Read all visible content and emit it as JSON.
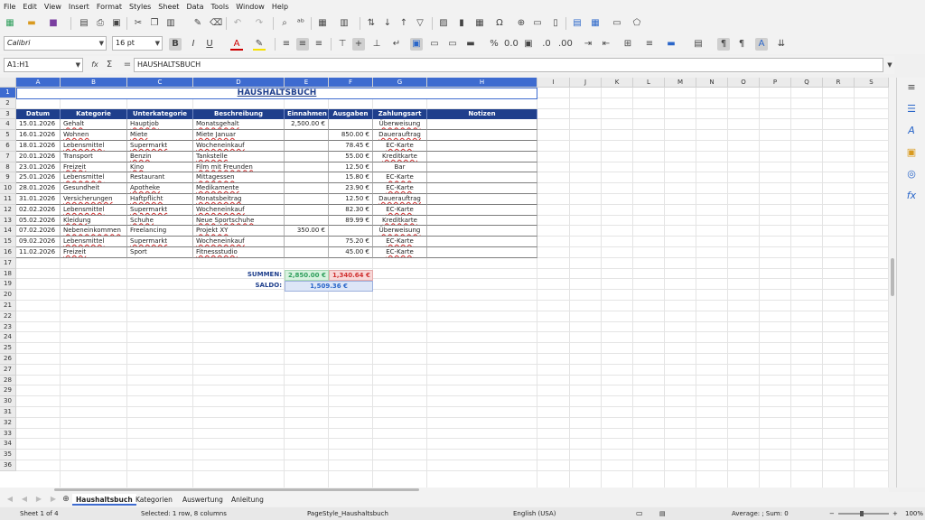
{
  "menu": [
    "File",
    "Edit",
    "View",
    "Insert",
    "Format",
    "Styles",
    "Sheet",
    "Data",
    "Tools",
    "Window",
    "Help"
  ],
  "toolbar": {
    "font_name": "Calibri",
    "font_size": "16 pt",
    "bold": "B",
    "italic": "I",
    "underline": "U"
  },
  "formula_bar": {
    "name_box": "A1:H1",
    "fx": "fx",
    "sigma": "Σ",
    "equals": "=",
    "content": "HAUSHALTSBUCH"
  },
  "columns": [
    "A",
    "B",
    "C",
    "D",
    "E",
    "F",
    "G",
    "H",
    "I",
    "J",
    "K",
    "L",
    "M",
    "N",
    "O",
    "P",
    "Q",
    "R",
    "S"
  ],
  "rows": [
    "1",
    "2",
    "3",
    "4",
    "5",
    "6",
    "7",
    "8",
    "9",
    "10",
    "11",
    "12",
    "13",
    "14",
    "15",
    "16",
    "17",
    "18",
    "19",
    "20",
    "21",
    "22",
    "23",
    "24",
    "25",
    "26",
    "27",
    "28",
    "29",
    "30",
    "31",
    "32",
    "33",
    "34",
    "35",
    "36"
  ],
  "sheet": {
    "title": "HAUSHALTSBUCH",
    "headers": [
      "Datum",
      "Kategorie",
      "Unterkategorie",
      "Beschreibung",
      "Einnahmen",
      "Ausgaben",
      "Zahlungsart",
      "Notizen"
    ],
    "data": [
      [
        "15.01.2026",
        "Gehalt",
        "Hauptjob",
        "Monatsgehalt",
        "2,500.00 €",
        "",
        "Überweisung",
        ""
      ],
      [
        "16.01.2026",
        "Wohnen",
        "Miete",
        "Miete Januar",
        "",
        "850.00 €",
        "Dauerauftrag",
        ""
      ],
      [
        "18.01.2026",
        "Lebensmittel",
        "Supermarkt",
        "Wocheneinkauf",
        "",
        "78.45 €",
        "EC-Karte",
        ""
      ],
      [
        "20.01.2026",
        "Transport",
        "Benzin",
        "Tankstelle",
        "",
        "55.00 €",
        "Kreditkarte",
        ""
      ],
      [
        "23.01.2026",
        "Freizeit",
        "Kino",
        "Film mit Freunden",
        "",
        "12.50 €",
        "Bar",
        ""
      ],
      [
        "25.01.2026",
        "Lebensmittel",
        "Restaurant",
        "Mittagessen",
        "",
        "15.80 €",
        "EC-Karte",
        ""
      ],
      [
        "28.01.2026",
        "Gesundheit",
        "Apotheke",
        "Medikamente",
        "",
        "23.90 €",
        "EC-Karte",
        ""
      ],
      [
        "31.01.2026",
        "Versicherungen",
        "Haftpflicht",
        "Monatsbeitrag",
        "",
        "12.50 €",
        "Dauerauftrag",
        ""
      ],
      [
        "02.02.2026",
        "Lebensmittel",
        "Supermarkt",
        "Wocheneinkauf",
        "",
        "82.30 €",
        "EC-Karte",
        ""
      ],
      [
        "05.02.2026",
        "Kleidung",
        "Schuhe",
        "Neue Sportschuhe",
        "",
        "89.99 €",
        "Kreditkarte",
        ""
      ],
      [
        "07.02.2026",
        "Nebeneinkommen",
        "Freelancing",
        "Projekt XY",
        "350.00 €",
        "",
        "Überweisung",
        ""
      ],
      [
        "09.02.2026",
        "Lebensmittel",
        "Supermarkt",
        "Wocheneinkauf",
        "",
        "75.20 €",
        "EC-Karte",
        ""
      ],
      [
        "11.02.2026",
        "Freizeit",
        "Sport",
        "Fitnessstudio",
        "",
        "45.00 €",
        "EC-Karte",
        ""
      ]
    ],
    "summen_label": "SUMMEN:",
    "summen_einnahmen": "2,850.00 €",
    "summen_ausgaben": "1,340.64 €",
    "saldo_label": "SALDO:",
    "saldo_value": "1,509.36 €"
  },
  "tabs": [
    "Haushaltsbuch",
    "Kategorien",
    "Auswertung",
    "Anleitung"
  ],
  "status": {
    "sheet": "Sheet 1 of 4",
    "selection": "Selected: 1 row, 8 columns",
    "page_style": "PageStyle_Haushaltsbuch",
    "language": "English (USA)",
    "average_sum": "Average: ; Sum: 0",
    "zoom": "100%"
  },
  "colors": {
    "header_bg": "#1f3f8c",
    "accent": "#3d6bd0",
    "income": "#2e9e5b",
    "expense": "#d03030"
  }
}
